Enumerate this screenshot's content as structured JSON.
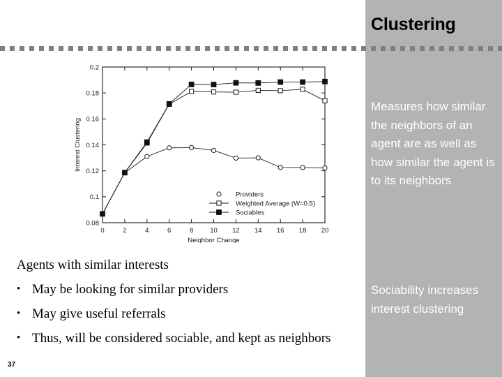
{
  "slide": {
    "title": "Clustering",
    "page_number": "37",
    "divider": "dashed-rule"
  },
  "side_panel": {
    "accent_bg": "#b3b3b3",
    "text_color": "#ffffff",
    "blocks": [
      {
        "text": "Measures how similar the neighbors of an agent are as well as how similar the agent is to its neighbors"
      },
      {
        "text": "Sociability increases interest clustering"
      }
    ]
  },
  "body": {
    "lead": "Agents with similar interests",
    "bullet_mark": "•",
    "bullets": [
      "May be looking for similar providers",
      "May give useful referrals",
      "Thus, will be considered sociable, and kept as neighbors"
    ]
  },
  "chart_data": {
    "type": "line",
    "title": "",
    "xlabel": "Neighbor Change",
    "ylabel": "Interest Clustering",
    "xlim": [
      0,
      20
    ],
    "ylim": [
      0.08,
      0.2
    ],
    "xticks": [
      "0",
      "2",
      "4",
      "6",
      "8",
      "10",
      "12",
      "14",
      "16",
      "18",
      "20"
    ],
    "yticks": [
      "0.08",
      "0.1",
      "0.12",
      "0.14",
      "0.16",
      "0.18",
      "0.2"
    ],
    "grid": false,
    "legend_position": "bottom-right",
    "x": [
      0,
      2,
      4,
      6,
      8,
      10,
      12,
      14,
      16,
      18,
      20
    ],
    "series": [
      {
        "name": "Providers",
        "marker": "circle-open",
        "values": [
          0.0868,
          0.1185,
          0.131,
          0.1377,
          0.1379,
          0.1357,
          0.1298,
          0.13,
          0.1226,
          0.1225,
          0.1222
        ]
      },
      {
        "name": "Weighted Average (W=0.5)",
        "marker": "square-open",
        "values": [
          0.0868,
          0.1185,
          0.1414,
          0.1713,
          0.1812,
          0.1808,
          0.1806,
          0.182,
          0.1818,
          0.1828,
          0.174
        ]
      },
      {
        "name": "Sociables",
        "marker": "square-filled",
        "values": [
          0.0868,
          0.1186,
          0.1421,
          0.1716,
          0.1866,
          0.1865,
          0.1878,
          0.1877,
          0.1884,
          0.1884,
          0.1888
        ]
      }
    ]
  }
}
